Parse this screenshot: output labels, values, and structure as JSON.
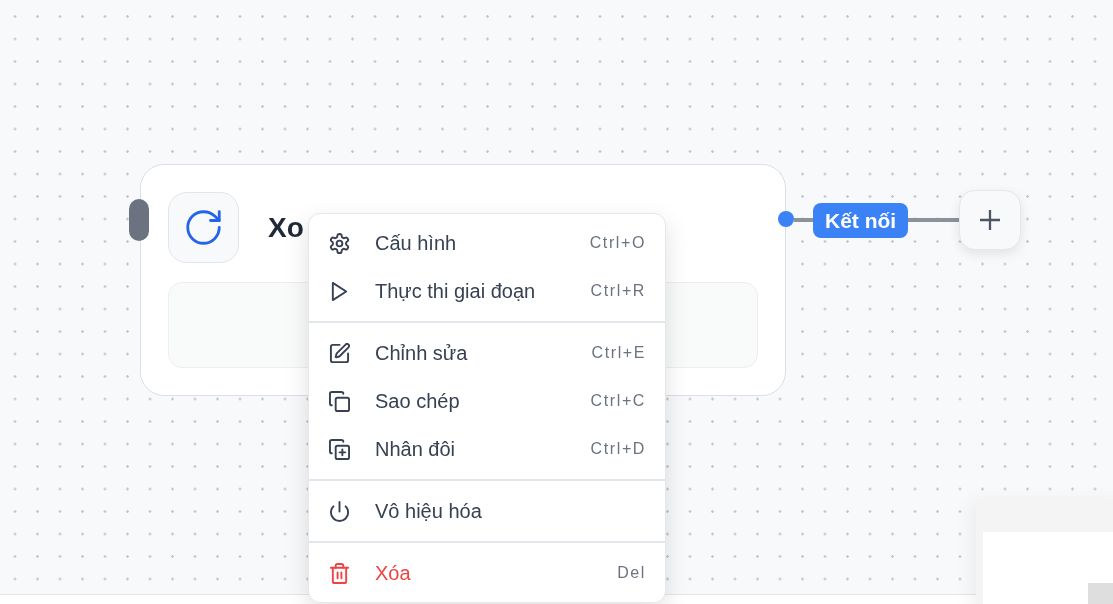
{
  "canvas": {
    "node": {
      "title": "Xo"
    },
    "edge": {
      "label": "Kết nối"
    }
  },
  "context_menu": {
    "sections": [
      {
        "items": [
          {
            "label": "Cấu hình",
            "shortcut": "Ctrl+O",
            "danger": false
          },
          {
            "label": "Thực thi giai đoạn",
            "shortcut": "Ctrl+R",
            "danger": false
          }
        ]
      },
      {
        "items": [
          {
            "label": "Chỉnh sửa",
            "shortcut": "Ctrl+E",
            "danger": false
          },
          {
            "label": "Sao chép",
            "shortcut": "Ctrl+C",
            "danger": false
          },
          {
            "label": "Nhân đôi",
            "shortcut": "Ctrl+D",
            "danger": false
          }
        ]
      },
      {
        "items": [
          {
            "label": "Vô hiệu hóa",
            "danger": false
          }
        ]
      },
      {
        "items": [
          {
            "label": "Xóa",
            "shortcut": "Del",
            "danger": true
          }
        ]
      }
    ]
  }
}
